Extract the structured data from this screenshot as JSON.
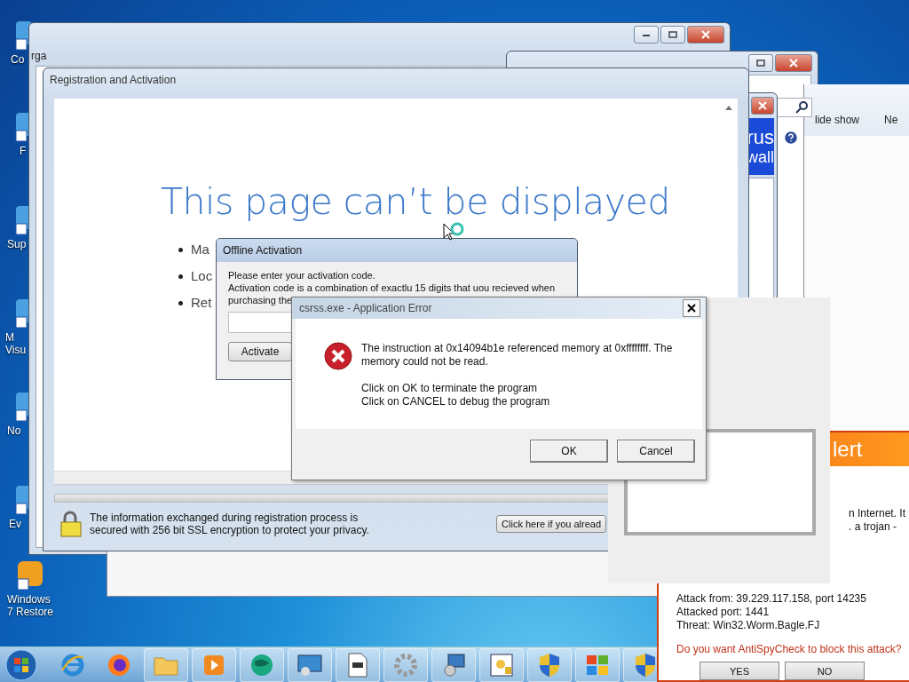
{
  "desktop_icons": [
    {
      "label": "Co"
    },
    {
      "label": "F"
    },
    {
      "label": "Sup"
    },
    {
      "label": "M Visu"
    },
    {
      "label": "No"
    },
    {
      "label": "Ev"
    },
    {
      "label": "Windows 7 Restore"
    }
  ],
  "explorer_window": {
    "toolbar_text": "rga"
  },
  "photo_window": {
    "menu": [
      "lide show",
      "Ne"
    ]
  },
  "antivirus_window": {
    "banner": [
      "rus",
      "wall"
    ]
  },
  "registration_window": {
    "title": "Registration and Activation",
    "heading": "This page can’t be displayed",
    "bullets": [
      "Ma",
      "Loc",
      "Ret"
    ],
    "security_note": "The information exchanged during registration process is secured with 256 bit SSL encryption to protect your privacy.",
    "button": "Click here if you alread"
  },
  "offline_activation": {
    "title": "Offline Activation",
    "prompt": "Please enter your activation code.",
    "info": "Activation code is a combination of exactlu 15 digits that uou recieved when purchasing the",
    "button": "Activate"
  },
  "error_dialog": {
    "title": "csrss.exe - Application Error",
    "message": "The instruction at 0x14094b1e referenced memory at 0xffffffff. The memory could not be read.",
    "instructions": [
      "Click on OK to terminate the program",
      "Click on CANCEL to debug the program"
    ],
    "buttons": [
      "OK",
      "Cancel"
    ]
  },
  "alert_window": {
    "header": "lert",
    "description": [
      "n Internet. It",
      ". a trojan -"
    ],
    "details": [
      "Attack from: 39.229.117.158, port 14235",
      "Attacked port: 1441",
      "Threat: Win32.Worm.Bagle.FJ"
    ],
    "question": "Do you want AntiSpyCheck to block this attack?",
    "buttons": [
      "YES",
      "NO"
    ]
  }
}
